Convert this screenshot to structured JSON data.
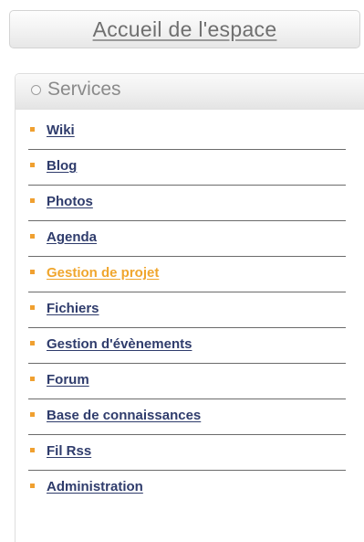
{
  "home": {
    "label": "Accueil de l'espace"
  },
  "services": {
    "title": "Services",
    "items": [
      {
        "label": "Wiki",
        "active": false
      },
      {
        "label": "Blog",
        "active": false
      },
      {
        "label": "Photos",
        "active": false
      },
      {
        "label": "Agenda",
        "active": false
      },
      {
        "label": "Gestion de projet",
        "active": true
      },
      {
        "label": "Fichiers",
        "active": false
      },
      {
        "label": "Gestion d'évènements",
        "active": false
      },
      {
        "label": "Forum",
        "active": false
      },
      {
        "label": "Base de connaissances",
        "active": false
      },
      {
        "label": "Fil Rss",
        "active": false
      },
      {
        "label": "Administration",
        "active": false
      }
    ]
  },
  "colors": {
    "link": "#2f3c6c",
    "active_link": "#f0a62e",
    "bullet": "#f0a030"
  }
}
